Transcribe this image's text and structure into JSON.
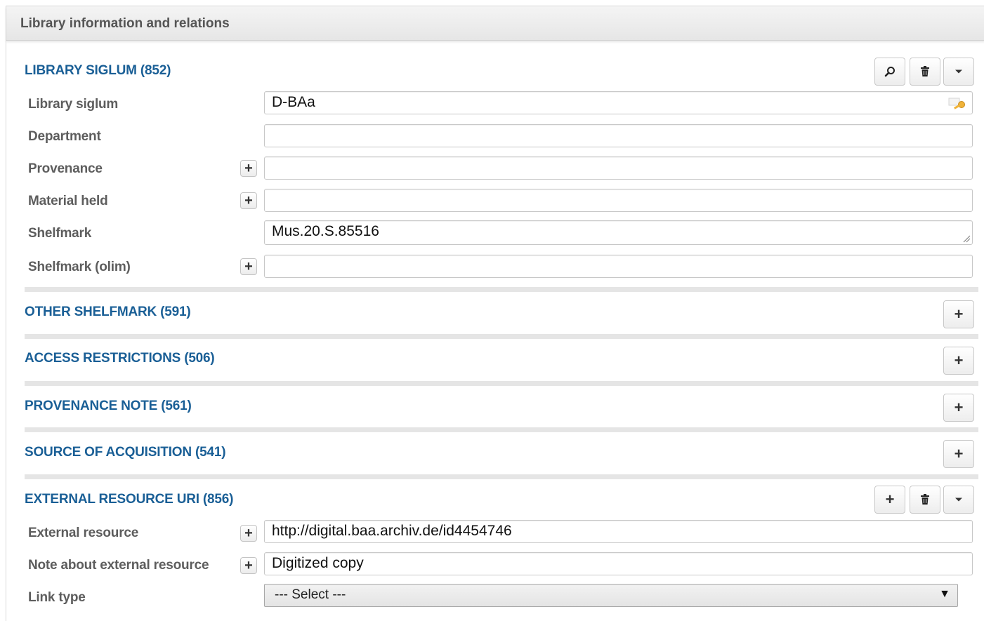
{
  "panel": {
    "title": "Library information and relations"
  },
  "library_siglum": {
    "title": "LIBRARY SIGLUM (852)",
    "fields": {
      "siglum_label": "Library siglum",
      "siglum_value": "D-BAa",
      "department_label": "Department",
      "department_value": "",
      "provenance_label": "Provenance",
      "provenance_value": "",
      "material_label": "Material held",
      "material_value": "",
      "shelfmark_label": "Shelfmark",
      "shelfmark_value": "Mus.20.S.85516",
      "shelfmark_olim_label": "Shelfmark (olim)",
      "shelfmark_olim_value": ""
    }
  },
  "other_shelfmark": {
    "title": "OTHER SHELFMARK (591)"
  },
  "access_restrictions": {
    "title": "ACCESS RESTRICTIONS (506)"
  },
  "provenance_note": {
    "title": "PROVENANCE NOTE (561)"
  },
  "source_acquisition": {
    "title": "SOURCE OF ACQUISITION (541)"
  },
  "external_resource": {
    "title": "EXTERNAL RESOURCE URI (856)",
    "fields": {
      "resource_label": "External resource",
      "resource_value": "http://digital.baa.archiv.de/id4454746",
      "note_label": "Note about external resource",
      "note_value": "Digitized copy",
      "link_type_label": "Link type",
      "link_type_selected": "--- Select ---"
    }
  },
  "icons": {
    "plus": "plus-icon",
    "search": "search-icon",
    "trash": "trash-icon",
    "caret": "caret-down-icon",
    "key": "key-icon",
    "resize": "resize-handle-icon"
  },
  "colors": {
    "section_title": "#1a5f96",
    "label": "#5d5d5d",
    "divider": "#e5e5e5"
  }
}
